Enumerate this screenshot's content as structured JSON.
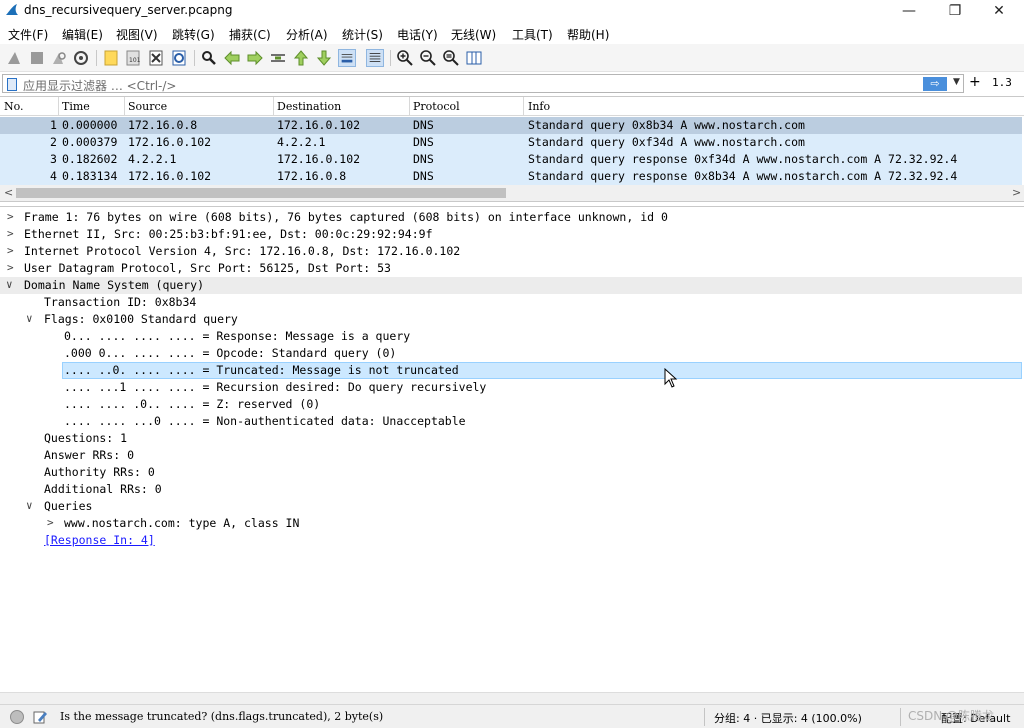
{
  "window": {
    "title": "dns_recursivequery_server.pcapng",
    "minimize_glyph": "—",
    "maximize_glyph": "❐",
    "close_glyph": "✕"
  },
  "menu": [
    "文件(F)",
    "编辑(E)",
    "视图(V)",
    "跳转(G)",
    "捕获(C)",
    "分析(A)",
    "统计(S)",
    "电话(Y)",
    "无线(W)",
    "工具(T)",
    "帮助(H)"
  ],
  "toolbar_icons": [
    "shark-fin-start-icon",
    "stop-icon",
    "restart-icon",
    "options-gear-icon",
    "open-folder-icon",
    "save-file-icon",
    "close-file-icon",
    "reload-icon",
    "find-icon",
    "go-back-icon",
    "go-forward-icon",
    "go-to-packet-icon",
    "go-first-icon",
    "go-last-icon",
    "autoscroll-icon",
    "colorize-icon",
    "zoom-in-icon",
    "zoom-out-icon",
    "zoom-normal-icon",
    "resize-columns-icon"
  ],
  "filter": {
    "placeholder": "应用显示过滤器 … <Ctrl-/>",
    "apply_glyph": "⇨",
    "dropdown_glyph": "▼",
    "add_glyph": "+",
    "version": "1.3"
  },
  "packet_list": {
    "columns": [
      "No.",
      "Time",
      "Source",
      "Destination",
      "Protocol",
      "Info"
    ],
    "rows": [
      {
        "no": "1",
        "time": "0.000000",
        "source": "172.16.0.8",
        "destination": "172.16.0.102",
        "protocol": "DNS",
        "info": "Standard query 0x8b34 A www.nostarch.com"
      },
      {
        "no": "2",
        "time": "0.000379",
        "source": "172.16.0.102",
        "destination": "4.2.2.1",
        "protocol": "DNS",
        "info": "Standard query 0xf34d A www.nostarch.com"
      },
      {
        "no": "3",
        "time": "0.182602",
        "source": "4.2.2.1",
        "destination": "172.16.0.102",
        "protocol": "DNS",
        "info": "Standard query response 0xf34d A www.nostarch.com A 72.32.92.4"
      },
      {
        "no": "4",
        "time": "0.183134",
        "source": "172.16.0.102",
        "destination": "172.16.0.8",
        "protocol": "DNS",
        "info": "Standard query response 0x8b34 A www.nostarch.com A 72.32.92.4"
      }
    ],
    "scroll_left": "<",
    "scroll_right": ">"
  },
  "detail": {
    "collapsed_glyph": ">",
    "expanded_glyph": "∨",
    "frame": "Frame 1: 76 bytes on wire (608 bits), 76 bytes captured (608 bits) on interface unknown, id 0",
    "ethernet": "Ethernet II, Src: 00:25:b3:bf:91:ee, Dst: 00:0c:29:92:94:9f",
    "ip": "Internet Protocol Version 4, Src: 172.16.0.8, Dst: 172.16.0.102",
    "udp": "User Datagram Protocol, Src Port: 56125, Dst Port: 53",
    "dns": "Domain Name System (query)",
    "transaction_id": "Transaction ID: 0x8b34",
    "flags": "Flags: 0x0100 Standard query",
    "flag_lines": [
      "0... .... .... .... = Response: Message is a query",
      ".000 0... .... .... = Opcode: Standard query (0)",
      ".... ..0. .... .... = Truncated: Message is not truncated",
      ".... ...1 .... .... = Recursion desired: Do query recursively",
      ".... .... .0.. .... = Z: reserved (0)",
      ".... .... ...0 .... = Non-authenticated data: Unacceptable"
    ],
    "questions": "Questions: 1",
    "answer_rrs": "Answer RRs: 0",
    "authority_rrs": "Authority RRs: 0",
    "additional_rrs": "Additional RRs: 0",
    "queries": "Queries",
    "query_item": "www.nostarch.com: type A, class IN",
    "response_in": "[Response In: 4]"
  },
  "status": {
    "message": "Is the message truncated? (dns.flags.truncated), 2 byte(s)",
    "packets": "分组: 4 · 已显示: 4 (100.0%)",
    "profile": "配置: Default",
    "watermark": "CSDN @陈腾龙"
  }
}
